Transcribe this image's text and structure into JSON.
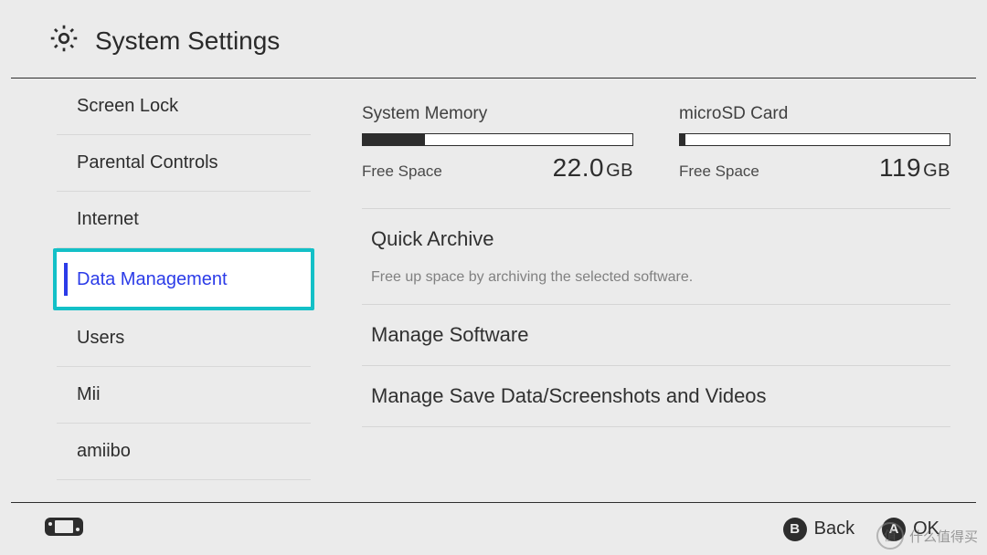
{
  "header": {
    "title": "System Settings"
  },
  "sidebar": {
    "items": [
      {
        "label": "Screen Lock",
        "selected": false
      },
      {
        "label": "Parental Controls",
        "selected": false
      },
      {
        "label": "Internet",
        "selected": false
      },
      {
        "label": "Data Management",
        "selected": true
      },
      {
        "label": "Users",
        "selected": false
      },
      {
        "label": "Mii",
        "selected": false
      },
      {
        "label": "amiibo",
        "selected": false
      }
    ]
  },
  "storage": {
    "systemMemory": {
      "title": "System Memory",
      "freeLabel": "Free Space",
      "value": "22.0",
      "unit": "GB",
      "usedPercent": 23
    },
    "sdCard": {
      "title": "microSD Card",
      "freeLabel": "Free Space",
      "value": "119",
      "unit": "GB",
      "usedPercent": 2
    }
  },
  "menu": {
    "quickArchive": {
      "title": "Quick Archive",
      "desc": "Free up space by archiving the selected software."
    },
    "manageSoftware": {
      "title": "Manage Software"
    },
    "manageSaveData": {
      "title": "Manage Save Data/Screenshots and Videos"
    }
  },
  "footer": {
    "b": {
      "glyph": "B",
      "label": "Back"
    },
    "a": {
      "glyph": "A",
      "label": "OK"
    }
  },
  "watermark": {
    "badge": "值",
    "text": "什么值得买"
  }
}
